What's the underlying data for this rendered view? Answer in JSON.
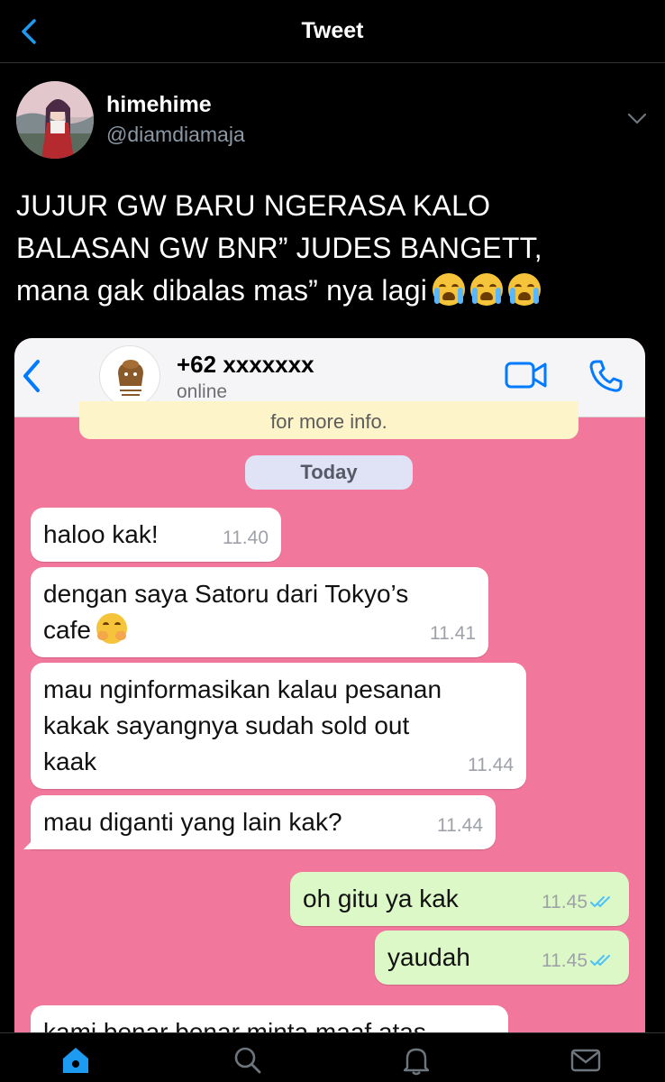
{
  "header": {
    "title": "Tweet"
  },
  "author": {
    "display_name": "himehime",
    "handle": "@diamdiamaja"
  },
  "tweet": {
    "lines": [
      "JUJUR GW BARU NGERASA KALO",
      "BALASAN GW BNR” JUDES BANGETT,",
      "mana gak dibalas mas” nya lagi"
    ],
    "emoji_name": "loudly-crying-face",
    "emoji_count": 3
  },
  "screenshot": {
    "contact_name": "+62 xxxxxxx",
    "contact_status": "online",
    "notice_text": "for more info.",
    "date_label": "Today",
    "messages": [
      {
        "direction": "in",
        "lines": [
          "haloo kak!"
        ],
        "time": "11.40"
      },
      {
        "direction": "in",
        "lines": [
          "dengan saya Satoru dari Tokyo’s",
          "cafe"
        ],
        "emoji": "hugging-face",
        "time": "11.41"
      },
      {
        "direction": "in",
        "lines": [
          "mau nginformasikan kalau pesanan",
          "kakak sayangnya sudah sold out",
          "kaak"
        ],
        "time": "11.44"
      },
      {
        "direction": "in",
        "lines": [
          "mau diganti yang lain kak?"
        ],
        "time": "11.44"
      },
      {
        "direction": "out",
        "lines": [
          "oh gitu ya kak"
        ],
        "time": "11.45",
        "status": "read"
      },
      {
        "direction": "out",
        "lines": [
          "yaudah"
        ],
        "time": "11.45",
        "status": "read"
      },
      {
        "direction": "in",
        "lines": [
          "kami benar benar minta maaf atas"
        ],
        "time": ""
      }
    ]
  },
  "nav": {
    "items": [
      "home-icon",
      "search-icon",
      "notifications-icon",
      "messages-icon"
    ],
    "active": "home-icon"
  },
  "colors": {
    "twitter_blue": "#1d9bf0",
    "chat_background": "#f2779d",
    "incoming_bubble": "#ffffff",
    "outgoing_bubble": "#dcf8c6",
    "ios_blue": "#007aff",
    "read_ticks": "#4fc3f7"
  }
}
